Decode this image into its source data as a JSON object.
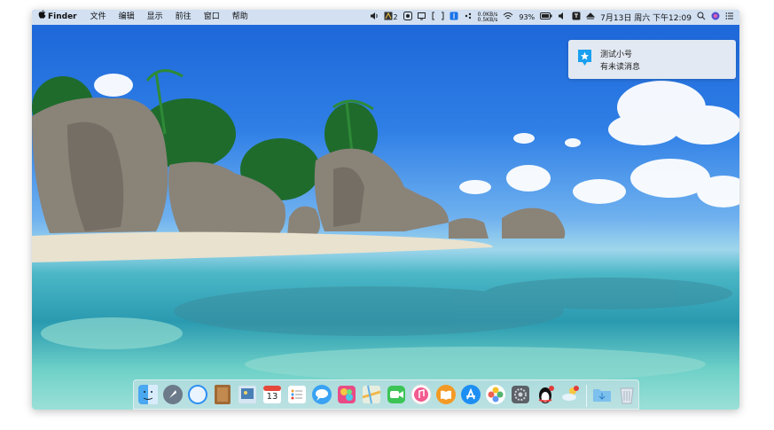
{
  "menubar": {
    "apple_icon": "apple-logo-icon",
    "app_name": "Finder",
    "menus": [
      "文件",
      "编辑",
      "显示",
      "前往",
      "窗口",
      "帮助"
    ],
    "status": {
      "volume_badge": "2",
      "net_up": "0.0KB/s",
      "net_down": "0.5KB/s",
      "battery": "93%",
      "clock": "7月13日 周六 下午12:09"
    }
  },
  "notification": {
    "title": "测试小号",
    "body": "有未读消息",
    "icon": "qq-star-icon"
  },
  "dock": {
    "apps": [
      "finder",
      "launchpad",
      "safari",
      "notes-book",
      "preview",
      "calendar",
      "reminders",
      "messages",
      "photo-booth",
      "maps",
      "facetime",
      "music",
      "books",
      "app-store",
      "photos",
      "system-preferences",
      "qq",
      "weather"
    ],
    "calendar_day": "13",
    "folders": [
      "downloads-folder",
      "trash"
    ]
  },
  "colors": {
    "sky": "#1b64d8",
    "sea": "#2a9ab0",
    "menubar": "#e2eaf4"
  }
}
